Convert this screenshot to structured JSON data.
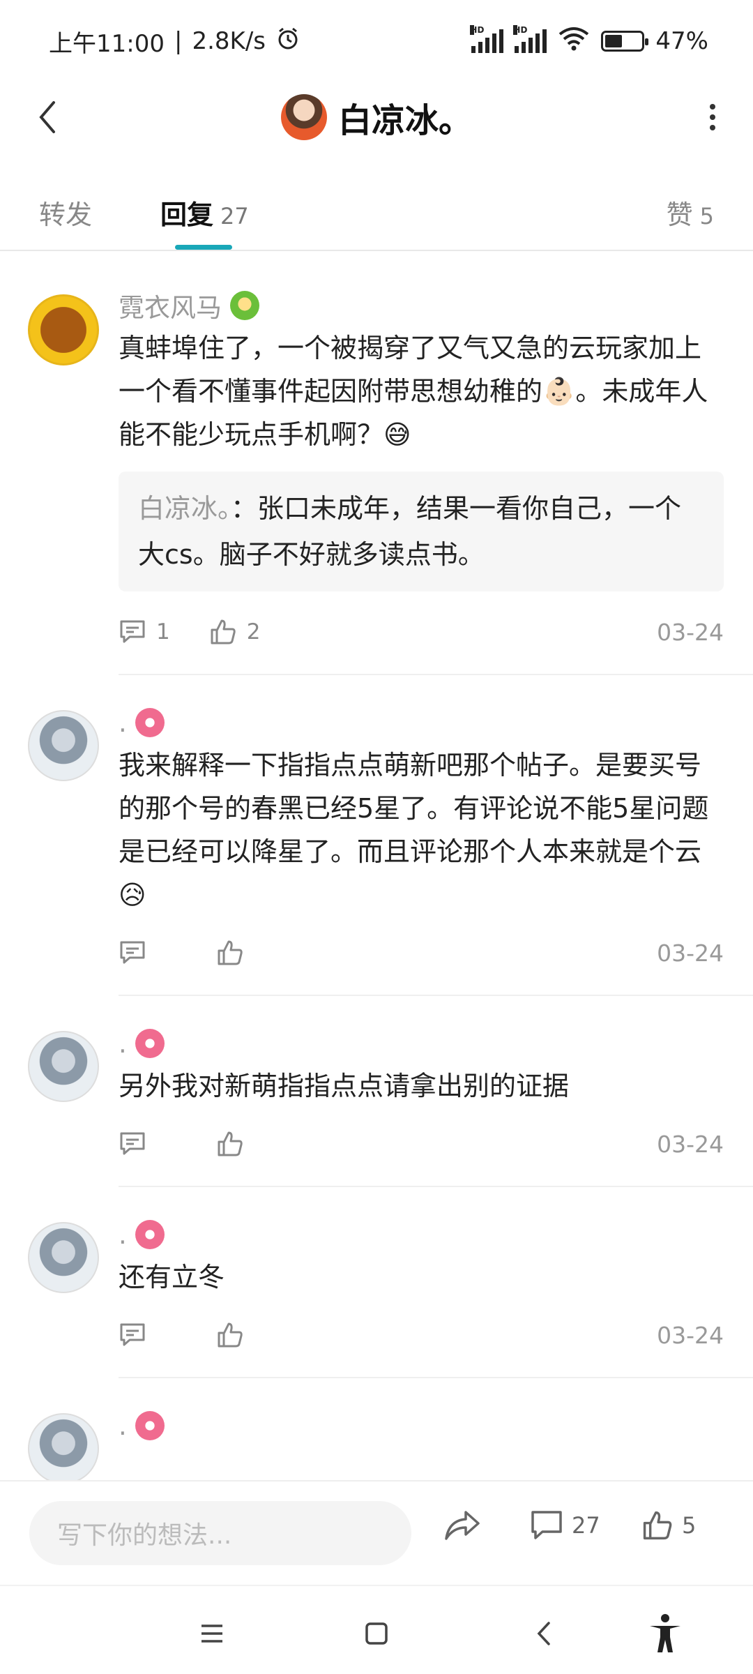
{
  "status_bar": {
    "time": "上午11:00",
    "speed": "2.8K/s",
    "hd_label": "HD",
    "battery": "47%",
    "battery_level": 0.47
  },
  "header": {
    "title": "白凉冰。"
  },
  "tabs": {
    "forward": "转发",
    "reply": "回复",
    "reply_count": "27",
    "like": "赞",
    "like_count": "5"
  },
  "comments": [
    {
      "user": "霓衣风马",
      "text": "真蚌埠住了，一个被揭穿了又气又急的云玩家加上一个看不懂事件起因附带思想幼稚的👶🏻。未成年人能不能少玩点手机啊？😅",
      "quote_name": "白凉冰。",
      "quote_text": "：张口未成年，结果一看你自己，一个大cs。脑子不好就多读点书。",
      "reply_count": "1",
      "like_count": "2",
      "date": "03-24"
    },
    {
      "user": ".",
      "text": "我来解释一下指指点点萌新吧那个帖子。是要买号的那个号的春黑已经5星了。有评论说不能5星问题是已经可以降星了。而且评论那个人本来就是个云😥",
      "date": "03-24"
    },
    {
      "user": ".",
      "text": "另外我对新萌指指点点请拿出别的证据",
      "date": "03-24"
    },
    {
      "user": ".",
      "text": "还有立冬",
      "date": "03-24"
    },
    {
      "user": "."
    }
  ],
  "bottom_bar": {
    "placeholder": "写下你的想法...",
    "comment_count": "27",
    "like_count": "5"
  }
}
